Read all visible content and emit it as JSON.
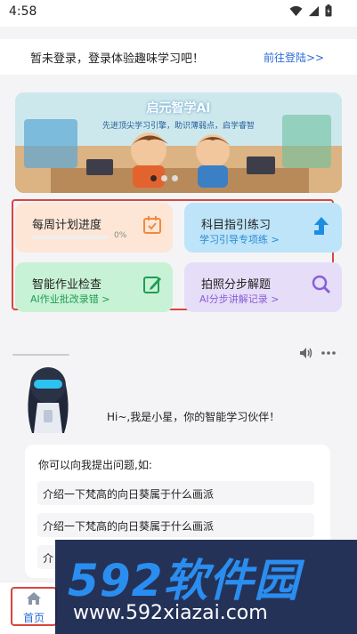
{
  "status_bar": {
    "time": "4:58"
  },
  "login_bar": {
    "text": "暂未登录，登录体验趣味学习吧！",
    "link": "前往登陆>>"
  },
  "banner": {
    "title": "启元智学AI",
    "subtitle": "先进顶尖学习引擎，助识薄弱点，启学睿智",
    "dots": 3,
    "active_dot": 0
  },
  "features": [
    {
      "title": "每周计划进度",
      "progress": 0,
      "progress_label": "0%",
      "icon": "calendar-check-icon"
    },
    {
      "title": "科目指引练习",
      "subtitle": "学习引导专项练 >",
      "icon": "arrow-up-icon"
    },
    {
      "title": "智能作业检查",
      "subtitle": "AI作业批改录错 >",
      "icon": "edit-icon"
    },
    {
      "title": "拍照分步解题",
      "subtitle": "AI分步讲解记录 >",
      "icon": "search-icon"
    }
  ],
  "chat": {
    "greeting": "Hi~,我是小星，你的智能学习伙伴！",
    "prompt_title": "你可以向我提出问题,如:",
    "questions": [
      "介绍一下梵高的向日葵属于什么画派",
      "介绍一下梵高的向日葵属于什么画派",
      "介"
    ]
  },
  "tabbar": {
    "home": "首页"
  },
  "watermark": {
    "big": "592软件园",
    "url": "www.592xiazai.com"
  },
  "colors": {
    "accent": "#2a6bd6",
    "highlight_border": "#d8463f"
  }
}
